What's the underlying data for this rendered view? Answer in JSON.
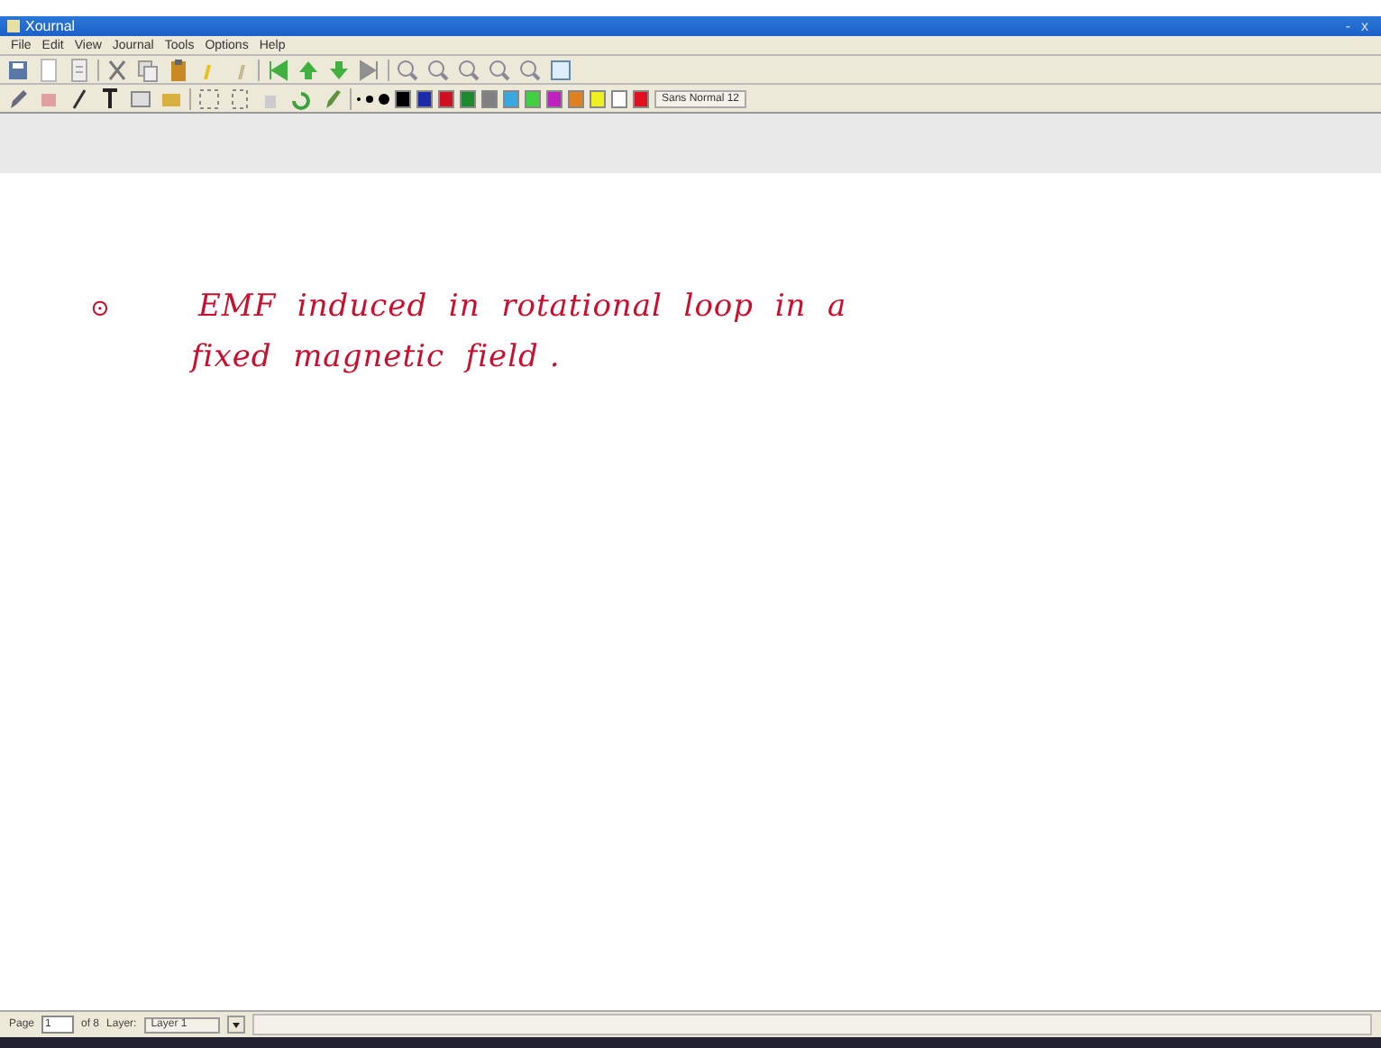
{
  "window": {
    "title": "Xournal",
    "controls": [
      "-",
      "x"
    ]
  },
  "menu": [
    "File",
    "Edit",
    "View",
    "Journal",
    "Tools",
    "Options",
    "Help"
  ],
  "palette": [
    {
      "color": "#000000"
    },
    {
      "color": "#1a2ca8"
    },
    {
      "color": "#d01020"
    },
    {
      "color": "#1e8a30"
    },
    {
      "color": "#808080"
    },
    {
      "color": "#38a8e0"
    },
    {
      "color": "#40d040"
    },
    {
      "color": "#c020c0"
    },
    {
      "color": "#e08020"
    },
    {
      "color": "#f0f020"
    },
    {
      "color": "#ffffff"
    },
    {
      "color": "#e01020"
    }
  ],
  "font_button": "Sans Normal 12",
  "note": {
    "bullet": "⊙",
    "lines": [
      "EMF  induced  in  rotational  loop  in  a",
      "fixed  magnetic  field ."
    ]
  },
  "status": {
    "page_label": "Page",
    "page": "1",
    "of": "of 8",
    "layer_label": "Layer:",
    "layer": "Layer 1"
  }
}
